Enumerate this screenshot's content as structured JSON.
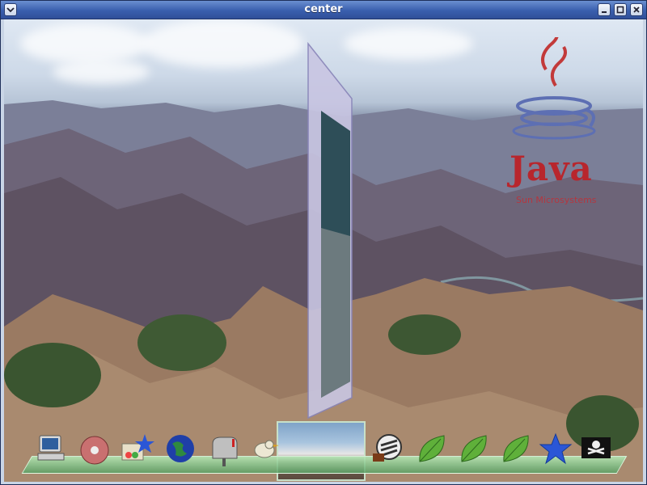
{
  "window": {
    "title": "center",
    "menu_icon": "chevron-down-icon",
    "controls": [
      "minimize-icon",
      "maximize-icon",
      "close-icon"
    ]
  },
  "background": {
    "scene": "canyon-landscape"
  },
  "java_logo": {
    "word": "Java",
    "tagline": "Sun Microsystems"
  },
  "dock": {
    "items": [
      {
        "name": "computer-icon"
      },
      {
        "name": "cd-disc-icon"
      },
      {
        "name": "palette-star-icon"
      },
      {
        "name": "globe-icon"
      },
      {
        "name": "mailbox-icon"
      },
      {
        "name": "bird-icon"
      },
      {
        "name": "film-reel-icon"
      },
      {
        "name": "leaf-icon"
      },
      {
        "name": "leaf-icon"
      },
      {
        "name": "leaf-icon"
      },
      {
        "name": "star-icon"
      },
      {
        "name": "pirate-flag-icon"
      }
    ]
  },
  "colors": {
    "titlebar": "#3a5fae",
    "java_red": "#b8262d",
    "java_blue": "#5d6fb3",
    "shelf": "#7fbf86"
  }
}
